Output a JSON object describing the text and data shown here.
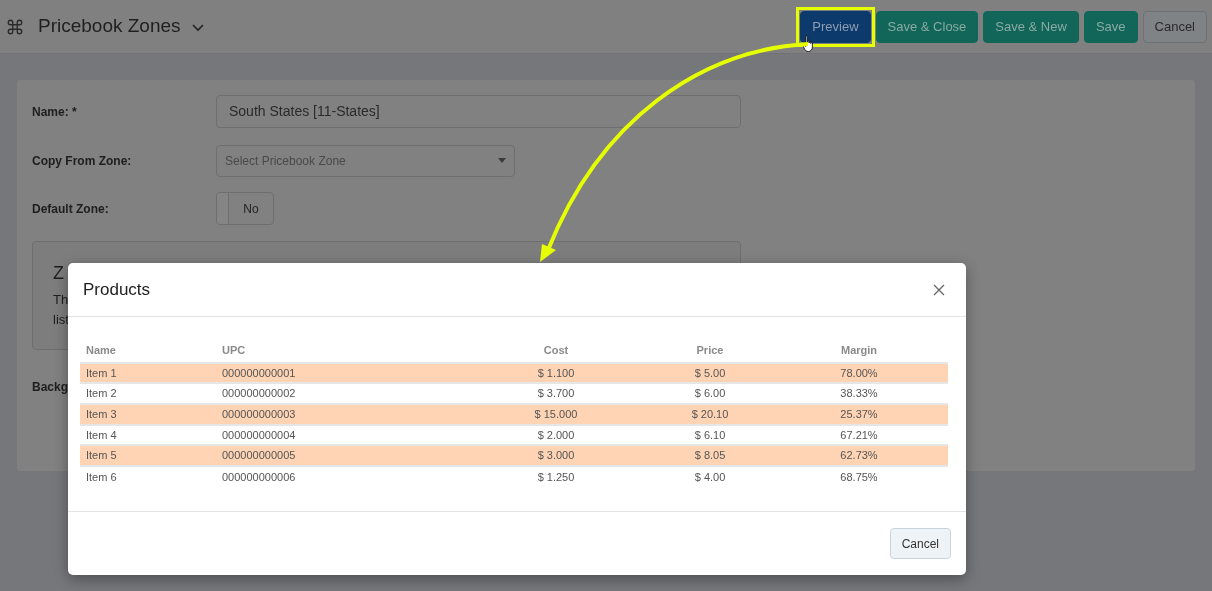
{
  "header": {
    "title": "Pricebook Zones",
    "actions": [
      {
        "label": "Preview",
        "kind": "primary",
        "highlighted": true
      },
      {
        "label": "Save & Close",
        "kind": "success",
        "highlighted": false
      },
      {
        "label": "Save & New",
        "kind": "success",
        "highlighted": false
      },
      {
        "label": "Save",
        "kind": "success",
        "highlighted": false
      },
      {
        "label": "Cancel",
        "kind": "secondary",
        "highlighted": false
      }
    ]
  },
  "form": {
    "name_label": "Name: *",
    "name_value": "South States [11-States]",
    "copy_label": "Copy From Zone:",
    "copy_placeholder": "Select Pricebook Zone",
    "default_label": "Default Zone:",
    "default_toggle": {
      "on": false,
      "label": "No"
    },
    "zone_box": {
      "heading": "Z",
      "lines": [
        "Th",
        "list"
      ]
    },
    "background_label": "Backg"
  },
  "modal": {
    "title": "Products",
    "columns": [
      "Name",
      "UPC",
      "Cost",
      "Price",
      "Margin"
    ],
    "rows": [
      [
        "Item 1",
        "000000000001",
        "$ 1.100",
        "$ 5.00",
        "78.00%"
      ],
      [
        "Item 2",
        "000000000002",
        "$ 3.700",
        "$ 6.00",
        "38.33%"
      ],
      [
        "Item 3",
        "000000000003",
        "$ 15.000",
        "$ 20.10",
        "25.37%"
      ],
      [
        "Item 4",
        "000000000004",
        "$ 2.000",
        "$ 6.10",
        "67.21%"
      ],
      [
        "Item 5",
        "000000000005",
        "$ 3.000",
        "$ 8.05",
        "62.73%"
      ],
      [
        "Item 6",
        "000000000006",
        "$ 1.250",
        "$ 4.00",
        "68.75%"
      ]
    ],
    "footer_button": "Cancel"
  }
}
